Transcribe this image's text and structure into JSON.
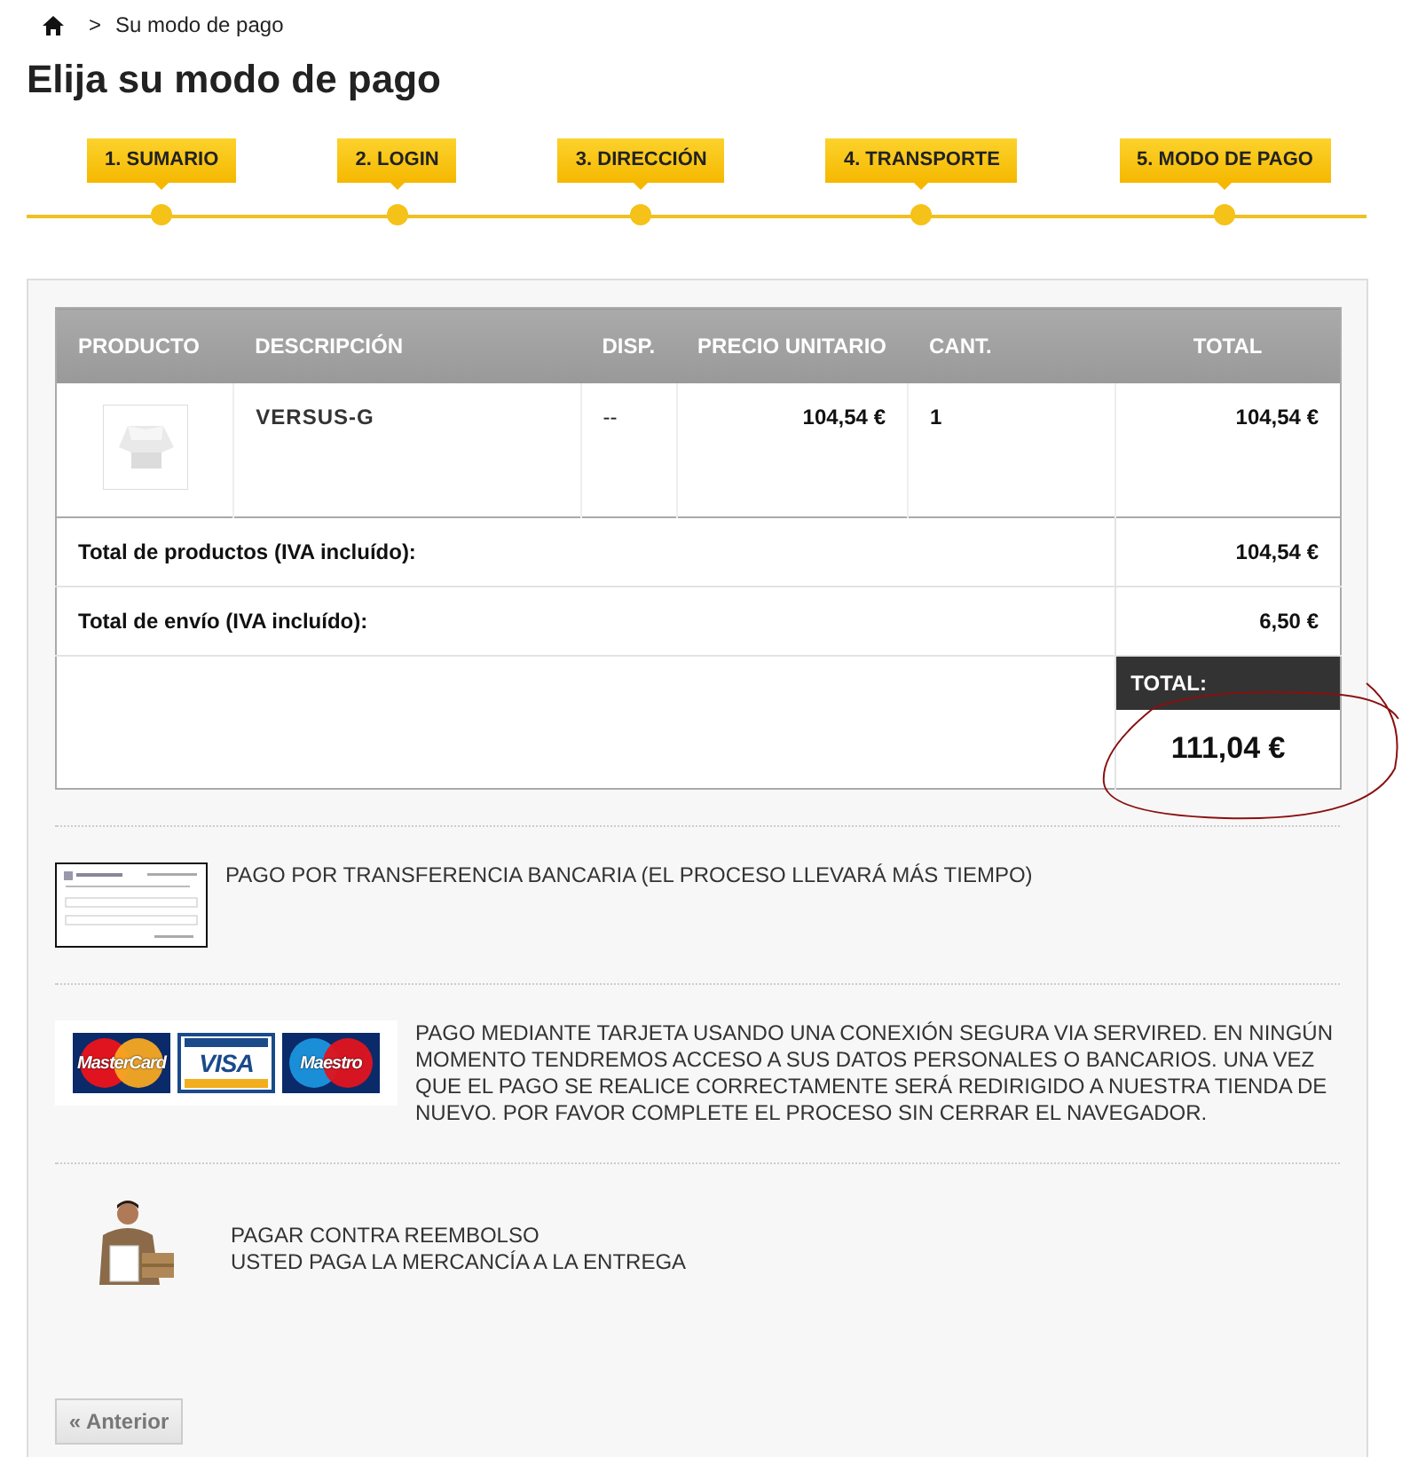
{
  "breadcrumb": {
    "current": "Su modo de pago",
    "separator": ">"
  },
  "title": "Elija su modo de pago",
  "steps": [
    {
      "label": "1. SUMARIO"
    },
    {
      "label": "2. LOGIN"
    },
    {
      "label": "3. DIRECCIÓN"
    },
    {
      "label": "4. TRANSPORTE"
    },
    {
      "label": "5. MODO DE PAGO"
    }
  ],
  "cart": {
    "columns": [
      "PRODUCTO",
      "DESCRIPCIÓN",
      "DISP.",
      "PRECIO UNITARIO",
      "CANT.",
      "TOTAL"
    ],
    "rows": [
      {
        "description": "VERSUS-G",
        "availability": "--",
        "unit_price": "104,54 €",
        "quantity": "1",
        "total": "104,54 €"
      }
    ],
    "summary": [
      {
        "label": "Total de productos (IVA incluído):",
        "value": "104,54 €"
      },
      {
        "label": "Total de envío (IVA incluído):",
        "value": "6,50 €"
      }
    ],
    "grand_total": {
      "label": "TOTAL:",
      "value": "111,04 €"
    }
  },
  "payment_methods": [
    {
      "kind": "transfer",
      "lines": [
        "PAGO POR TRANSFERENCIA BANCARIA (EL PROCESO LLEVARÁ MÁS TIEMPO)"
      ]
    },
    {
      "kind": "card",
      "cards": [
        "MasterCard",
        "VISA",
        "Maestro"
      ],
      "lines": [
        "PAGO MEDIANTE TARJETA USANDO UNA CONEXIÓN SEGURA VIA SERVIRED. EN NINGÚN MOMENTO TENDREMOS ACCESO A SUS DATOS PERSONALES O BANCARIOS. UNA VEZ QUE EL PAGO SE REALICE CORRECTAMENTE SERÁ REDIRIGIDO A NUESTRA TIENDA DE NUEVO. POR FAVOR COMPLETE EL PROCESO SIN CERRAR EL NAVEGADOR."
      ]
    },
    {
      "kind": "cod",
      "lines": [
        "PAGAR CONTRA REEMBOLSO",
        "USTED PAGA LA MERCANCÍA A LA ENTREGA"
      ]
    }
  ],
  "back_button": {
    "label": "« Anterior",
    "disabled": true
  }
}
